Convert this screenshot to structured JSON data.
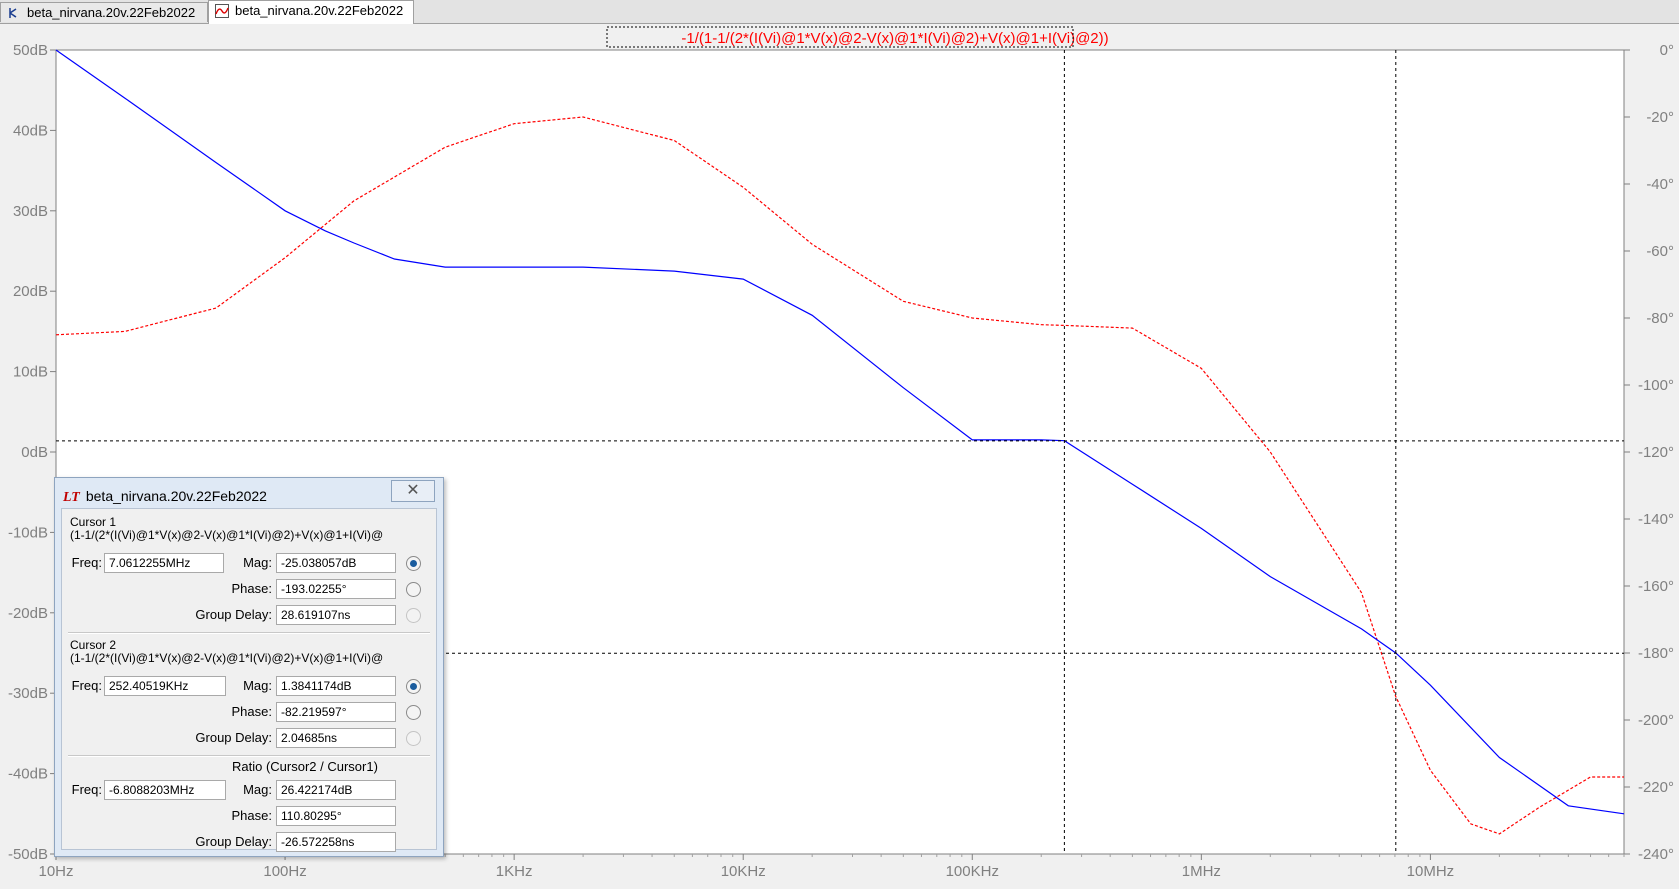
{
  "tabs": [
    {
      "label": "beta_nirvana.20v.22Feb2022",
      "icon": "schematic-icon",
      "active": false
    },
    {
      "label": "beta_nirvana.20v.22Feb2022",
      "icon": "waveform-icon",
      "active": true
    }
  ],
  "plot": {
    "trace_expression": "-1/(1-1/(2*(I(Vi)@1*V(x)@2-V(x)@1*I(Vi)@2)+V(x)@1+I(Vi)@2))",
    "colors": {
      "magnitude": "#0000ff",
      "phase": "#ff0000",
      "background": "#ffffff",
      "cursor": "#000000"
    },
    "x_ticks": [
      "10Hz",
      "100Hz",
      "1KHz",
      "10KHz",
      "100KHz",
      "1MHz",
      "10MHz"
    ],
    "y_left_ticks": [
      "50dB",
      "40dB",
      "30dB",
      "20dB",
      "10dB",
      "0dB",
      "-10dB",
      "-20dB",
      "-30dB",
      "-40dB",
      "-50dB"
    ],
    "y_right_ticks": [
      "0°",
      "-20°",
      "-40°",
      "-60°",
      "-80°",
      "-100°",
      "-120°",
      "-140°",
      "-160°",
      "-180°",
      "-200°",
      "-220°",
      "-240°"
    ]
  },
  "chart_data": {
    "type": "line",
    "x_scale": "log",
    "xlim": [
      10,
      70000000
    ],
    "ylim_left_dB": [
      -50,
      50
    ],
    "ylim_right_deg": [
      -240,
      0
    ],
    "series": [
      {
        "axis": "left",
        "x": [
          10,
          20,
          50,
          100,
          150,
          200,
          300,
          500,
          1000,
          2000,
          5000,
          10000,
          20000,
          50000,
          100000,
          200000,
          252405,
          500000,
          1000000,
          2000000,
          5000000,
          7061225,
          10000000,
          20000000,
          40000000,
          70000000
        ],
        "y": [
          50,
          44,
          36,
          30,
          27.5,
          26,
          24,
          23,
          23,
          23,
          22.5,
          21.5,
          17,
          8,
          1.5,
          1.5,
          1.4,
          -4,
          -9.5,
          -15.5,
          -22,
          -25,
          -29,
          -38,
          -44,
          -45
        ]
      },
      {
        "axis": "right",
        "x": [
          10,
          20,
          50,
          100,
          200,
          500,
          1000,
          2000,
          5000,
          10000,
          20000,
          50000,
          100000,
          200000,
          252405,
          500000,
          1000000,
          2000000,
          5000000,
          7061225,
          10000000,
          15000000,
          20000000,
          30000000,
          50000000,
          70000000
        ],
        "y": [
          -85,
          -84,
          -77,
          -62,
          -45,
          -29,
          -22,
          -20,
          -27,
          -41,
          -58,
          -75,
          -80,
          -82,
          -82.2,
          -83,
          -95,
          -120,
          -162,
          -193,
          -215,
          -231,
          -234,
          -226,
          -217,
          -217
        ]
      }
    ],
    "cursors": [
      {
        "freq_hz": 7061225.5,
        "mag_db": -25.038057,
        "phase_deg": -193.02255
      },
      {
        "freq_hz": 252405.19,
        "mag_db": 1.3841174,
        "phase_deg": -82.219597
      }
    ]
  },
  "cursor_window": {
    "title": "beta_nirvana.20v.22Feb2022",
    "close_glyph": "✕",
    "cursor1": {
      "title": "Cursor 1",
      "expr": "(1-1/(2*(I(Vi)@1*V(x)@2-V(x)@1*I(Vi)@2)+V(x)@1+I(Vi)@",
      "freq_label": "Freq:",
      "freq": "7.0612255MHz",
      "mag_label": "Mag:",
      "mag": "-25.038057dB",
      "phase_label": "Phase:",
      "phase": "-193.02255°",
      "gd_label": "Group Delay:",
      "gd": "28.619107ns"
    },
    "cursor2": {
      "title": "Cursor 2",
      "expr": "(1-1/(2*(I(Vi)@1*V(x)@2-V(x)@1*I(Vi)@2)+V(x)@1+I(Vi)@",
      "freq_label": "Freq:",
      "freq": "252.40519KHz",
      "mag_label": "Mag:",
      "mag": "1.3841174dB",
      "phase_label": "Phase:",
      "phase": "-82.219597°",
      "gd_label": "Group Delay:",
      "gd": "2.04685ns"
    },
    "ratio": {
      "title": "Ratio (Cursor2 / Cursor1)",
      "freq_label": "Freq:",
      "freq": "-6.8088203MHz",
      "mag_label": "Mag:",
      "mag": "26.422174dB",
      "phase_label": "Phase:",
      "phase": "110.80295°",
      "gd_label": "Group Delay:",
      "gd": "-26.572258ns"
    }
  }
}
